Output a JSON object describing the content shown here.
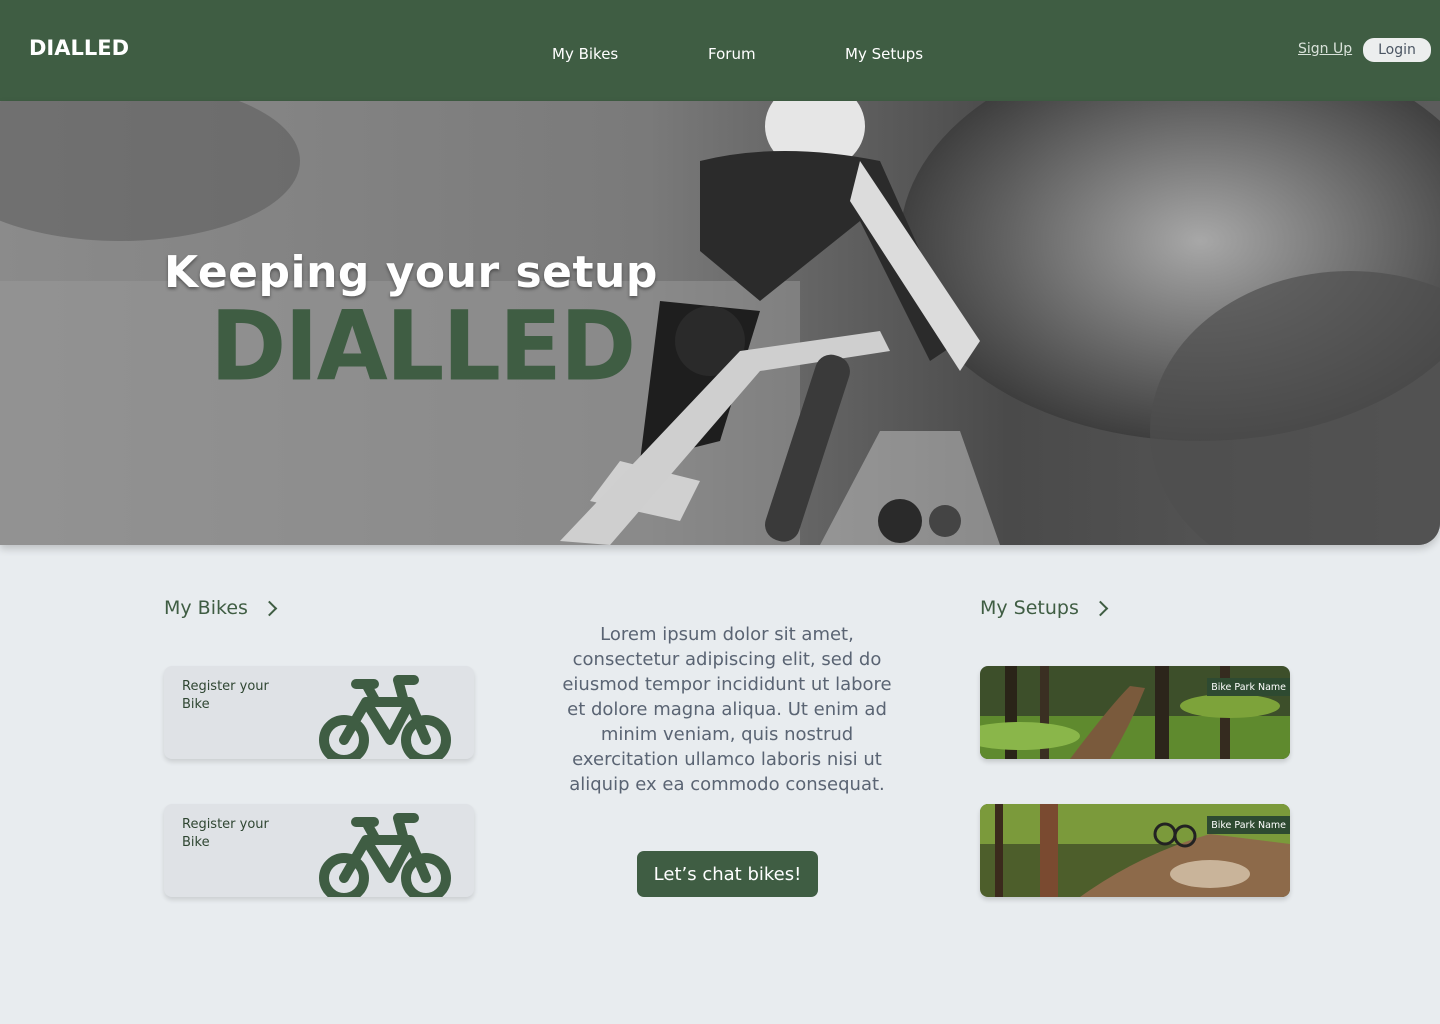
{
  "header": {
    "logo": "DIALLED",
    "nav": [
      {
        "label": "My Bikes"
      },
      {
        "label": "Forum"
      },
      {
        "label": "My Setups"
      }
    ],
    "signup_label": "Sign Up",
    "login_label": "Login"
  },
  "hero": {
    "title": "Keeping your setup",
    "brand": "DIALLED"
  },
  "bikes": {
    "heading": "My Bikes",
    "cards": [
      {
        "label": "Register your Bike",
        "icon": "bicycle-icon"
      },
      {
        "label": "Register your Bike",
        "icon": "bicycle-icon"
      }
    ]
  },
  "intro": {
    "text": "Lorem ipsum dolor sit amet, consectetur adipiscing elit, sed do eiusmod tempor incididunt ut labore et dolore magna aliqua. Ut enim ad minim veniam, quis nostrud exercitation ullamco laboris nisi ut aliquip ex ea commodo consequat.",
    "cta_label": "Let’s chat bikes!"
  },
  "setups": {
    "heading": "My Setups",
    "cards": [
      {
        "tag": "Bike Park Name"
      },
      {
        "tag": "Bike Park Name"
      }
    ]
  },
  "colors": {
    "brand_green": "#3f5d43",
    "page_bg": "#e8ecef",
    "card_bg": "#dfe2e6"
  }
}
